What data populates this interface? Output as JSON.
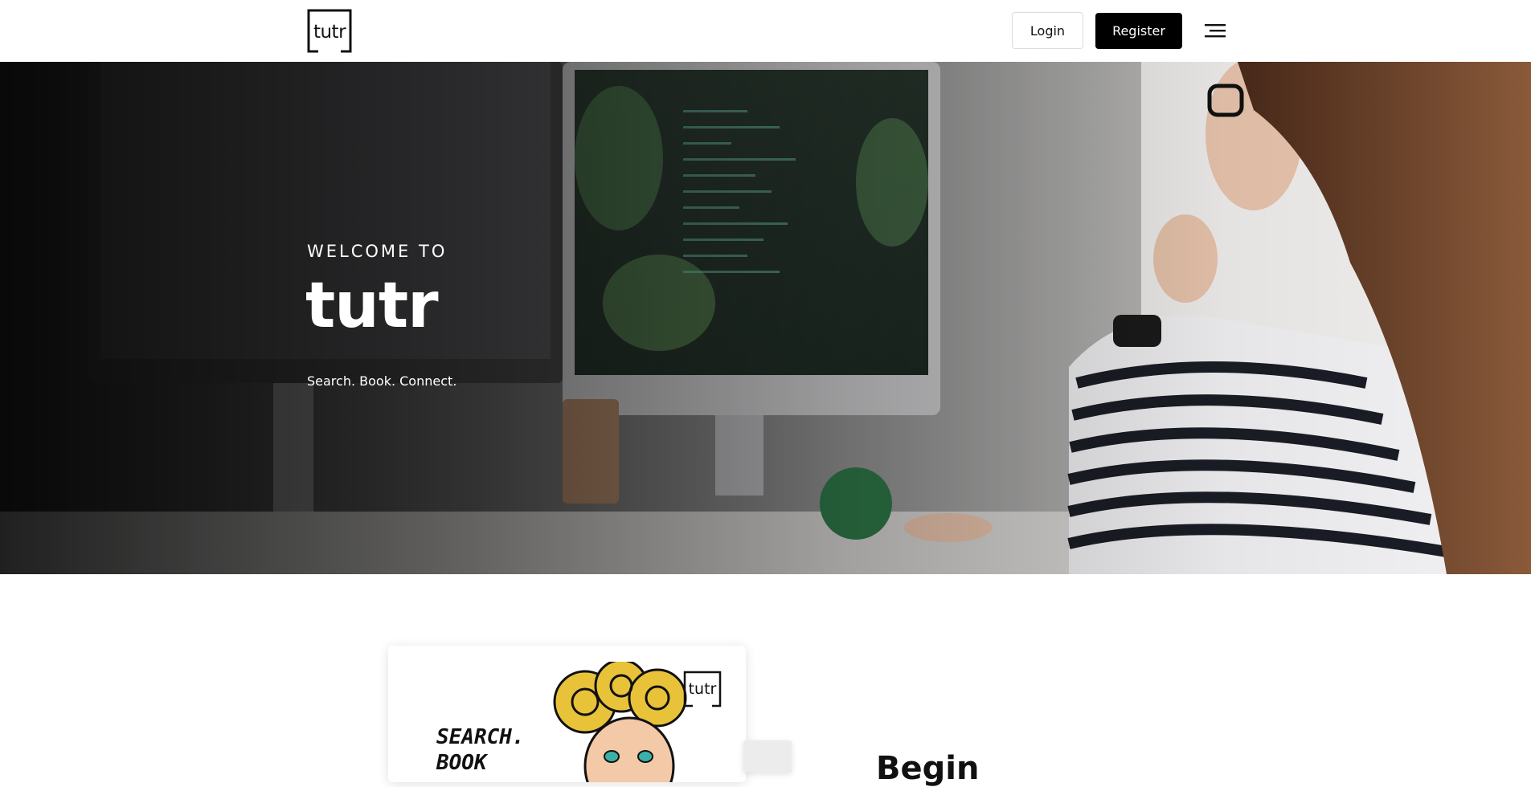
{
  "header": {
    "logo_text": "tutr",
    "login_label": "Login",
    "register_label": "Register",
    "menu_icon": "hamburger-menu-icon"
  },
  "hero": {
    "kicker": "WELCOME TO",
    "title": "tutr",
    "tagline": "Search. Book. Connect."
  },
  "feature_card": {
    "logo_text": "tutr",
    "headline": "SEARCH.\nBOOK"
  },
  "section": {
    "heading": "Begin"
  },
  "colors": {
    "brand_dark": "#000000",
    "background": "#ffffff",
    "accent_yellow": "#e8c33a",
    "accent_teal": "#3ab0a8"
  }
}
